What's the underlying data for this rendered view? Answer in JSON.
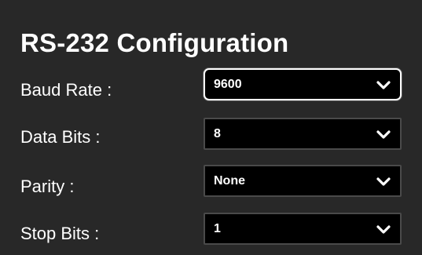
{
  "panel": {
    "title": "RS-232 Configuration"
  },
  "fields": [
    {
      "label": "Baud Rate :",
      "value": "9600",
      "icon": "chevron-down-icon"
    },
    {
      "label": "Data Bits :",
      "value": "8",
      "icon": "chevron-down-icon"
    },
    {
      "label": "Parity :",
      "value": "None",
      "icon": "chevron-down-icon"
    },
    {
      "label": "Stop Bits :",
      "value": "1",
      "icon": "chevron-down-icon"
    }
  ],
  "colors": {
    "background": "#282828",
    "select_background": "#000000",
    "text": "#ffffff",
    "select_border": "#4a4a4a",
    "focus_border": "#ffffff"
  }
}
